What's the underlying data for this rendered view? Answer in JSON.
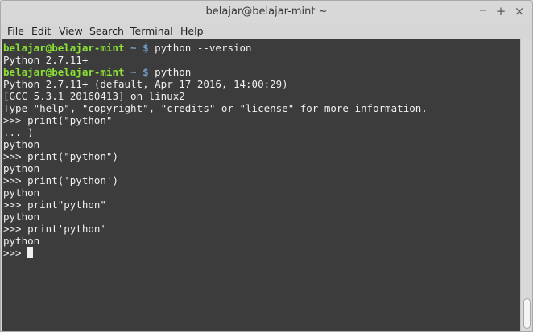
{
  "window": {
    "title": "belajar@belajar-mint ~",
    "controls": {
      "minimize": "−",
      "maximize": "+",
      "close": "×"
    }
  },
  "menu": [
    "File",
    "Edit",
    "View",
    "Search",
    "Terminal",
    "Help"
  ],
  "terminal": {
    "prompt_user": "belajar@belajar-mint",
    "prompt_path": "~",
    "prompt_symbol": "$",
    "lines": [
      {
        "type": "prompt",
        "cmd": "python --version"
      },
      {
        "type": "out",
        "text": "Python 2.7.11+"
      },
      {
        "type": "prompt",
        "cmd": "python"
      },
      {
        "type": "out",
        "text": "Python 2.7.11+ (default, Apr 17 2016, 14:00:29)"
      },
      {
        "type": "out",
        "text": "[GCC 5.3.1 20160413] on linux2"
      },
      {
        "type": "out",
        "text": "Type \"help\", \"copyright\", \"credits\" or \"license\" for more information."
      },
      {
        "type": "out",
        "text": ">>> print(\"python\""
      },
      {
        "type": "out",
        "text": "... )"
      },
      {
        "type": "out",
        "text": "python"
      },
      {
        "type": "out",
        "text": ">>> print(\"python\")"
      },
      {
        "type": "out",
        "text": "python"
      },
      {
        "type": "out",
        "text": ">>> print('python')"
      },
      {
        "type": "out",
        "text": "python"
      },
      {
        "type": "out",
        "text": ">>> print\"python\""
      },
      {
        "type": "out",
        "text": "python"
      },
      {
        "type": "out",
        "text": ">>> print'python'"
      },
      {
        "type": "out",
        "text": "python"
      },
      {
        "type": "cursor",
        "text": ">>> "
      }
    ]
  }
}
